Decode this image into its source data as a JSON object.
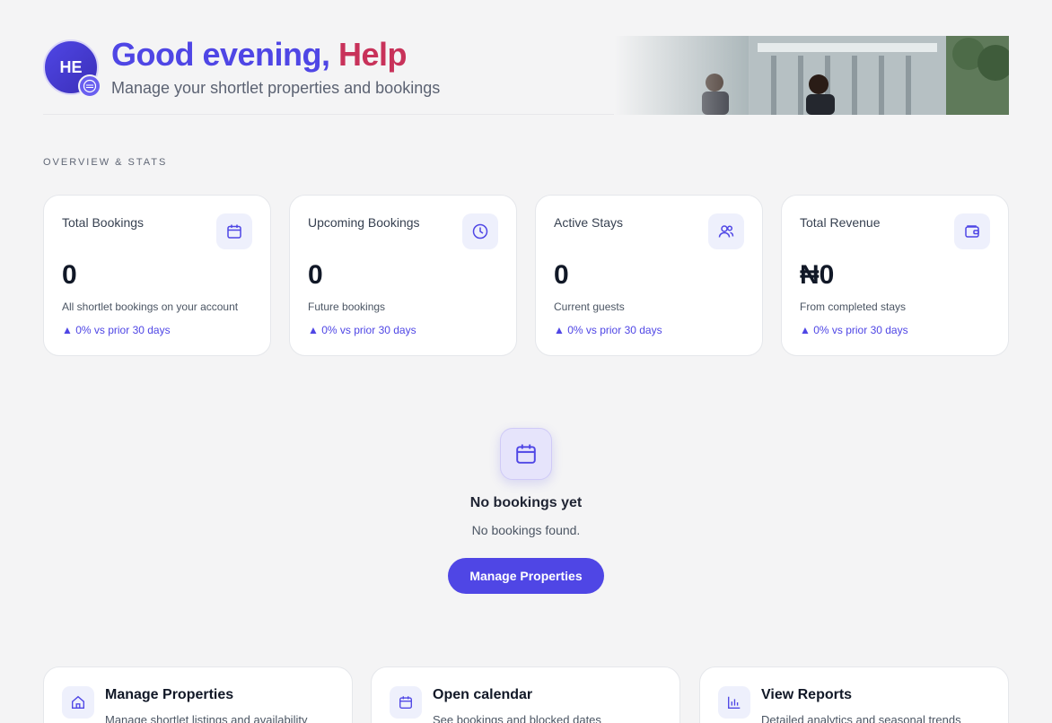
{
  "colors": {
    "accent": "#4f46e5",
    "name_highlight": "#c8325a",
    "card_bg": "#ffffff",
    "page_bg": "#f4f4f5"
  },
  "header": {
    "avatar_initials": "HE",
    "greeting": "Good evening,",
    "name": "Help",
    "subtitle": "Manage your shortlet properties and bookings"
  },
  "section_label": "OVERVIEW & STATS",
  "stats": [
    {
      "title": "Total Bookings",
      "value": "0",
      "desc": "All shortlet bookings on your account",
      "trend": "▲ 0% vs prior 30 days",
      "icon": "calendar-icon"
    },
    {
      "title": "Upcoming Bookings",
      "value": "0",
      "desc": "Future bookings",
      "trend": "▲ 0% vs prior 30 days",
      "icon": "clock-icon"
    },
    {
      "title": "Active Stays",
      "value": "0",
      "desc": "Current guests",
      "trend": "▲ 0% vs prior 30 days",
      "icon": "users-icon"
    },
    {
      "title": "Total Revenue",
      "value": "₦0",
      "desc": "From completed stays",
      "trend": "▲ 0% vs prior 30 days",
      "icon": "wallet-icon"
    }
  ],
  "empty_state": {
    "icon": "calendar-icon",
    "title": "No bookings yet",
    "subtitle": "No bookings found.",
    "button": "Manage Properties"
  },
  "actions": [
    {
      "title": "Manage Properties",
      "desc": "Manage shortlet listings and availability",
      "icon": "home-icon"
    },
    {
      "title": "Open calendar",
      "desc": "See bookings and blocked dates",
      "icon": "calendar-icon"
    },
    {
      "title": "View Reports",
      "desc": "Detailed analytics and seasonal trends",
      "icon": "bar-chart-icon"
    }
  ]
}
